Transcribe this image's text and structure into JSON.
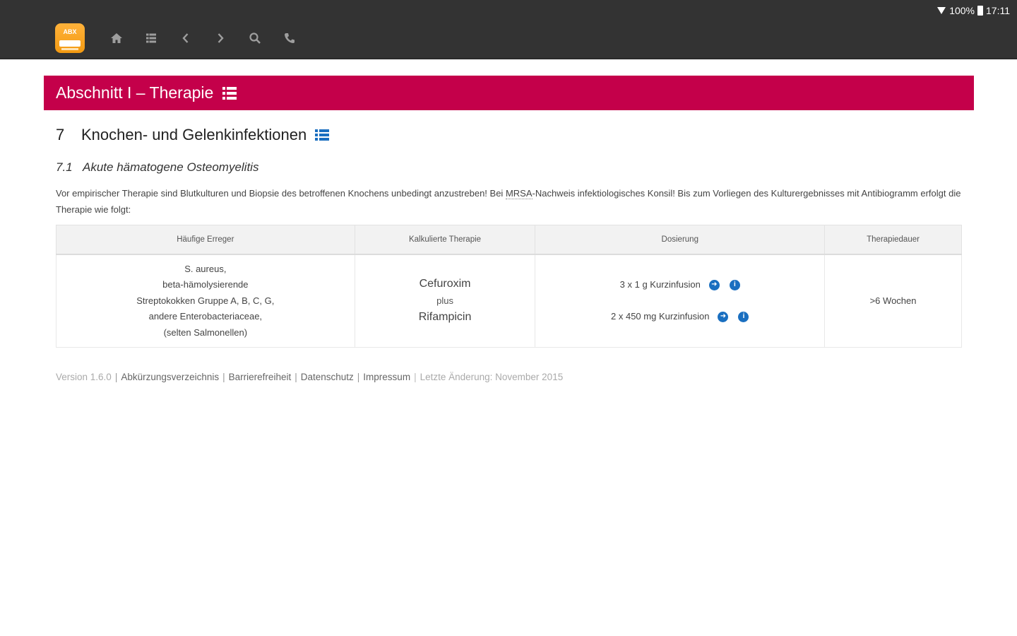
{
  "status_bar": {
    "battery": "100%",
    "time": "17:11"
  },
  "app": {
    "logo_text": "ABX"
  },
  "toolbar": {
    "buttons": [
      {
        "name": "home-button",
        "icon": "home-icon"
      },
      {
        "name": "contents-button",
        "icon": "list-icon"
      },
      {
        "name": "back-button",
        "icon": "chevron-left-icon"
      },
      {
        "name": "forward-button",
        "icon": "chevron-right-icon"
      },
      {
        "name": "search-button",
        "icon": "search-icon"
      },
      {
        "name": "phone-button",
        "icon": "phone-icon"
      }
    ]
  },
  "section": {
    "title": "Abschnitt I – Therapie",
    "color": "#c4004a"
  },
  "chapter": {
    "number": "7",
    "title": "Knochen- und Gelenkinfektionen"
  },
  "subchapter": {
    "number": "7.1",
    "title": "Akute hämatogene Osteomyelitis"
  },
  "intro": {
    "before_abbr": "Vor empirischer Therapie sind Blutkulturen und Biopsie des betroffenen Knochens unbedingt anzustreben! Bei ",
    "abbr": "MRSA",
    "after_abbr": "-Nachweis infektiologisches Konsil! Bis zum Vorliegen des Kulturergebnisses mit Antibiogramm erfolgt die Therapie wie folgt:"
  },
  "table": {
    "headers": [
      "Häufige Erreger",
      "Kalkulierte Therapie",
      "Dosierung",
      "Therapiedauer"
    ],
    "row": {
      "pathogens": [
        "S. aureus,",
        "beta-hämolysierende",
        "Streptokokken Gruppe A, B, C, G,",
        "andere Enterobacteriaceae,",
        "(selten Salmonellen)"
      ],
      "therapy": {
        "drug1": "Cefuroxim",
        "plus": "plus",
        "drug2": "Rifampicin"
      },
      "doses": [
        "3 x 1 g Kurzinfusion",
        "2 x 450 mg Kurzinfusion"
      ],
      "duration": ">6 Wochen"
    }
  },
  "footer": {
    "version": "Version 1.6.0",
    "links": [
      "Abkürzungsverzeichnis",
      "Barrierefreiheit",
      "Datenschutz",
      "Impressum"
    ],
    "last_change": "Letzte Änderung: November 2015"
  },
  "colors": {
    "accent_icon": "#1a6fc0",
    "toolbar_bg": "#333333",
    "app_logo": "#f39a12"
  }
}
